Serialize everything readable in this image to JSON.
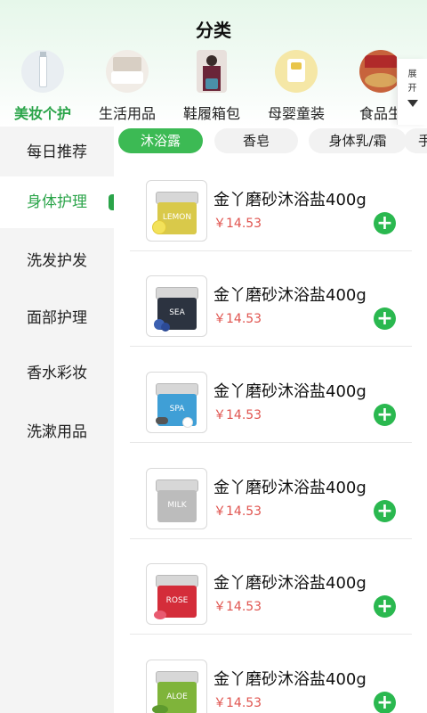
{
  "header": {
    "title": "分类"
  },
  "categories": [
    {
      "label": "美妆个护",
      "active": true
    },
    {
      "label": "生活用品",
      "active": false
    },
    {
      "label": "鞋履箱包",
      "active": false
    },
    {
      "label": "母婴童装",
      "active": false
    },
    {
      "label": "食品生",
      "active": false
    }
  ],
  "expand": {
    "line1": "展",
    "line2": "开"
  },
  "sidebar": {
    "items": [
      {
        "label": "每日推荐",
        "active": false
      },
      {
        "label": "身体护理",
        "active": true
      },
      {
        "label": "洗发护发",
        "active": false
      },
      {
        "label": "面部护理",
        "active": false
      },
      {
        "label": "香水彩妆",
        "active": false
      },
      {
        "label": "洗漱用品",
        "active": false
      }
    ]
  },
  "subtabs": [
    {
      "label": "沐浴露",
      "active": true
    },
    {
      "label": "香皂",
      "active": false
    },
    {
      "label": "身体乳/霜",
      "active": false
    },
    {
      "label": "手",
      "active": false
    }
  ],
  "products": [
    {
      "name": "金丫磨砂沐浴盐400g",
      "price": "￥14.53",
      "jar_text": "LEMON",
      "jar_color": "#d9c94a"
    },
    {
      "name": "金丫磨砂沐浴盐400g",
      "price": "￥14.53",
      "jar_text": "SEA",
      "jar_color": "#2c3340"
    },
    {
      "name": "金丫磨砂沐浴盐400g",
      "price": "￥14.53",
      "jar_text": "SPA",
      "jar_color": "#3f9fd6"
    },
    {
      "name": "金丫磨砂沐浴盐400g",
      "price": "￥14.53",
      "jar_text": "MILK",
      "jar_color": "#bcbcbc"
    },
    {
      "name": "金丫磨砂沐浴盐400g",
      "price": "￥14.53",
      "jar_text": "ROSE",
      "jar_color": "#d42d3a"
    },
    {
      "name": "金丫磨砂沐浴盐400g",
      "price": "￥14.53",
      "jar_text": "ALOE",
      "jar_color": "#7fb43a"
    }
  ],
  "add_icon": "plus-icon",
  "colors": {
    "accent": "#2aa449",
    "price": "#e0544f"
  }
}
